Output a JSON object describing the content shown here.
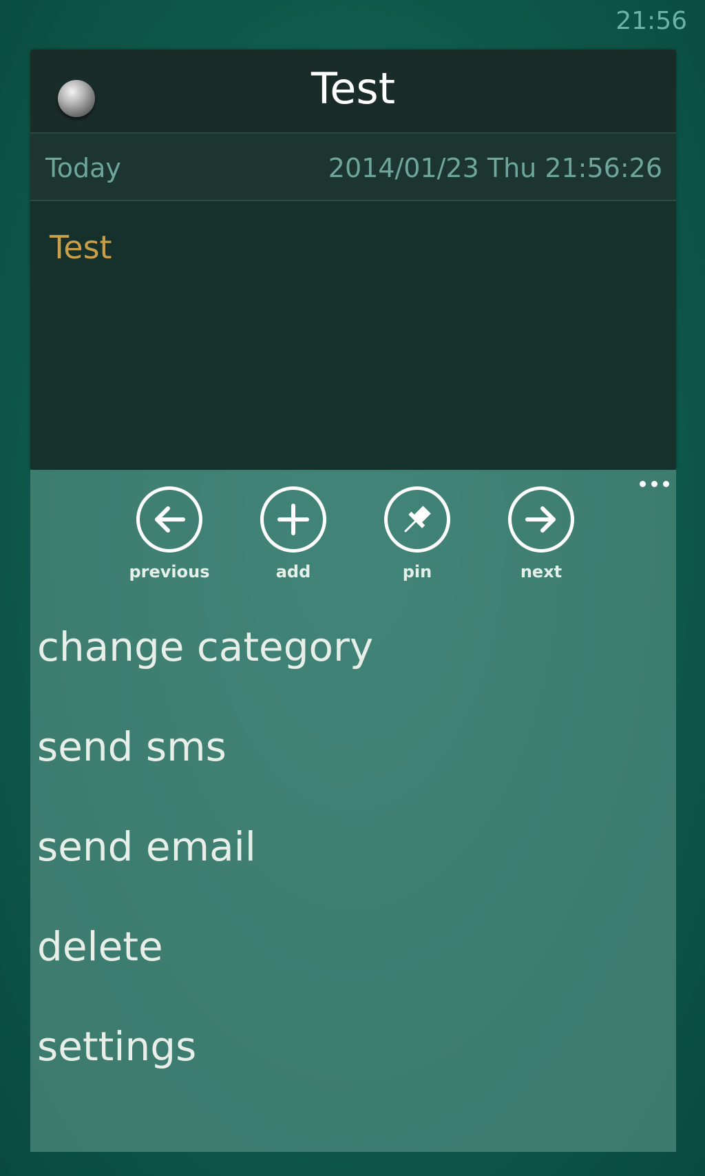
{
  "status_bar": {
    "time": "21:56"
  },
  "note": {
    "title": "Test",
    "date_label": "Today",
    "date_value": "2014/01/23 Thu 21:56:26",
    "body": "Test"
  },
  "appbar": {
    "buttons": [
      {
        "label": "previous",
        "icon": "arrow-left-icon"
      },
      {
        "label": "add",
        "icon": "plus-icon"
      },
      {
        "label": "pin",
        "icon": "pin-icon"
      },
      {
        "label": "next",
        "icon": "arrow-right-icon"
      }
    ],
    "menu_items": [
      {
        "label": "change category"
      },
      {
        "label": "send sms"
      },
      {
        "label": "send email"
      },
      {
        "label": "delete"
      },
      {
        "label": "settings"
      }
    ]
  }
}
